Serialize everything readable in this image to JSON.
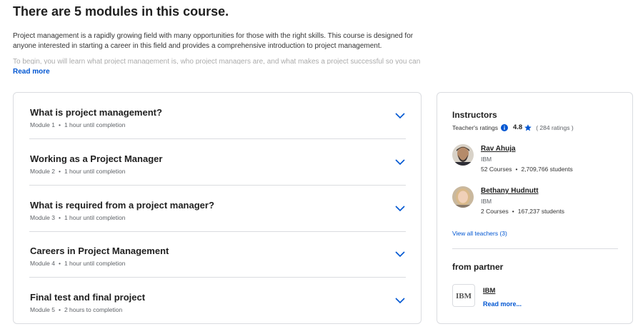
{
  "header": {
    "title": "There are 5 modules in this course.",
    "description": "Project management is a rapidly growing field with many opportunities for those with the right skills. This course is designed for anyone interested in starting a career in this field and provides a comprehensive introduction to project management.",
    "description_continued": "To begin, you will learn what project management is, who project managers are, and what makes a project successful so you can apply these foundational concepts to your career.",
    "read_more": "Read more"
  },
  "modules": [
    {
      "title": "What is project management?",
      "module_label": "Module 1",
      "duration": "1 hour until completion"
    },
    {
      "title": "Working as a Project Manager",
      "module_label": "Module 2",
      "duration": "1 hour until completion"
    },
    {
      "title": "What is required from a project manager?",
      "module_label": "Module 3",
      "duration": "1 hour until completion"
    },
    {
      "title": "Careers in Project Management",
      "module_label": "Module 4",
      "duration": "1 hour until completion"
    },
    {
      "title": "Final test and final project",
      "module_label": "Module 5",
      "duration": "2 hours to completion"
    }
  ],
  "sidebar": {
    "instructors_heading": "Instructors",
    "ratings_label": "Teacher's ratings",
    "rating_value": "4.8",
    "rating_count": "( 284 ratings )",
    "instructors": [
      {
        "name": "Rav Ahuja",
        "org": "IBM",
        "courses": "52 Courses",
        "students": "2,709,766 students"
      },
      {
        "name": "Bethany Hudnutt",
        "org": "IBM",
        "courses": "2 Courses",
        "students": "167,237 students"
      }
    ],
    "view_all": "View all teachers (3)",
    "partner_heading": "from partner",
    "partner": {
      "logo_text": "IBM",
      "name": "IBM",
      "read_more": "Read more..."
    }
  },
  "colors": {
    "link": "#0056d2",
    "border": "#dadce0",
    "star": "#0056d2"
  },
  "icons": {
    "chevron": "chevron-down-icon",
    "info": "info-icon",
    "star": "star-icon"
  }
}
